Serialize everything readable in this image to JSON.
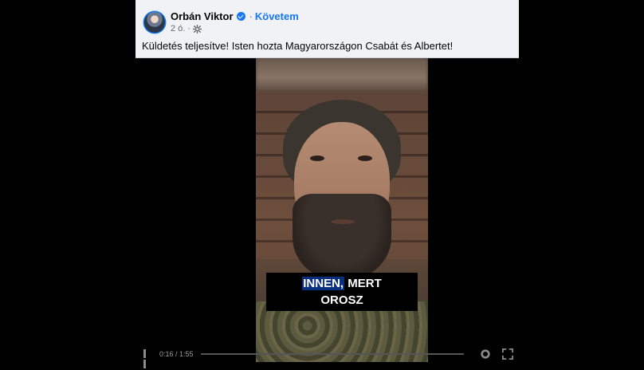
{
  "post": {
    "author": "Orbán Viktor",
    "follow_label": "Követem",
    "separator": "·",
    "time": "2 ó.",
    "text": "Küldetés teljesítve! Isten hozta Magyarországon Csabát és Albertet!"
  },
  "video": {
    "caption_highlight": "INNEN,",
    "caption_rest": " MERT",
    "caption_line2": "OROSZ",
    "time_display": "0:16 / 1:55"
  }
}
